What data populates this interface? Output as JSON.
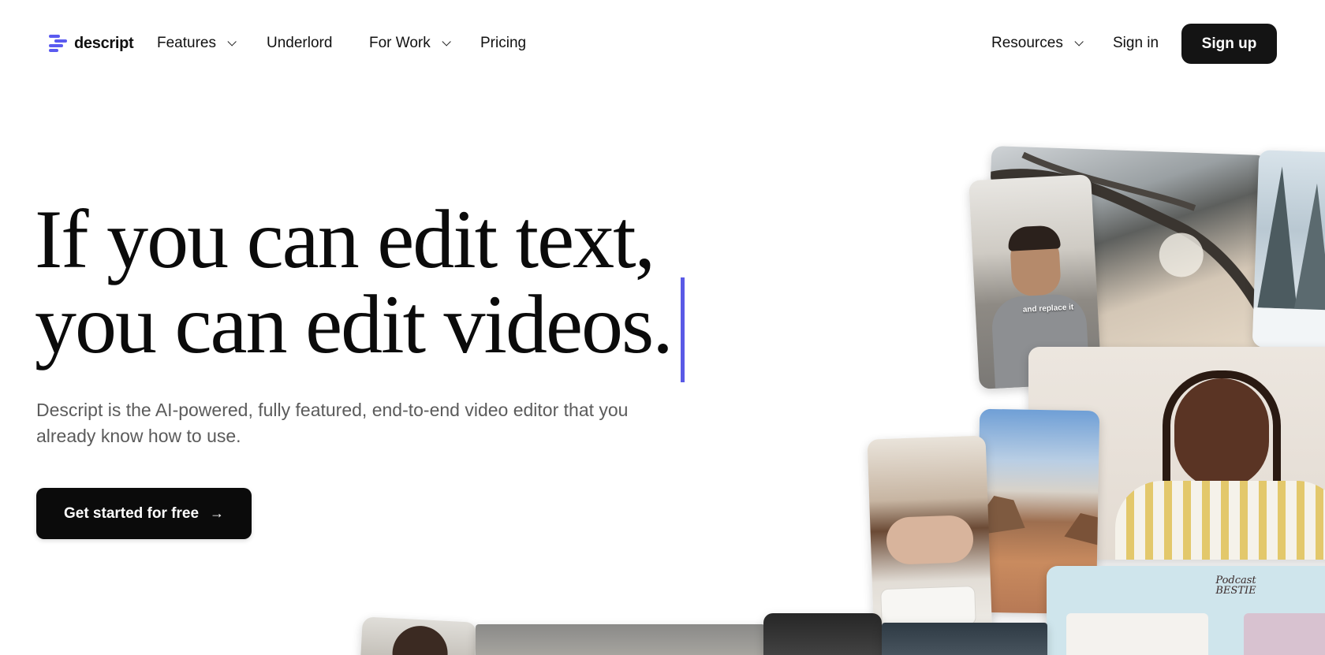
{
  "brand": {
    "name": "descript",
    "accent": "#5a5af0"
  },
  "nav": {
    "features": "Features",
    "underlord": "Underlord",
    "for_work": "For Work",
    "pricing": "Pricing",
    "resources": "Resources",
    "sign_in": "Sign in",
    "sign_up": "Sign up"
  },
  "hero": {
    "headline_line1": "If you can edit text,",
    "headline_line2": "you can edit videos.",
    "subhead": "Descript is the AI-powered, fully featured, end-to-end video editor that you already know how to use.",
    "cta_label": "Get started for free",
    "cta_icon": "arrow-right-icon"
  },
  "collage": {
    "creator_caption": "and replace it",
    "podcast_brand": "Podcast BESTIE"
  }
}
